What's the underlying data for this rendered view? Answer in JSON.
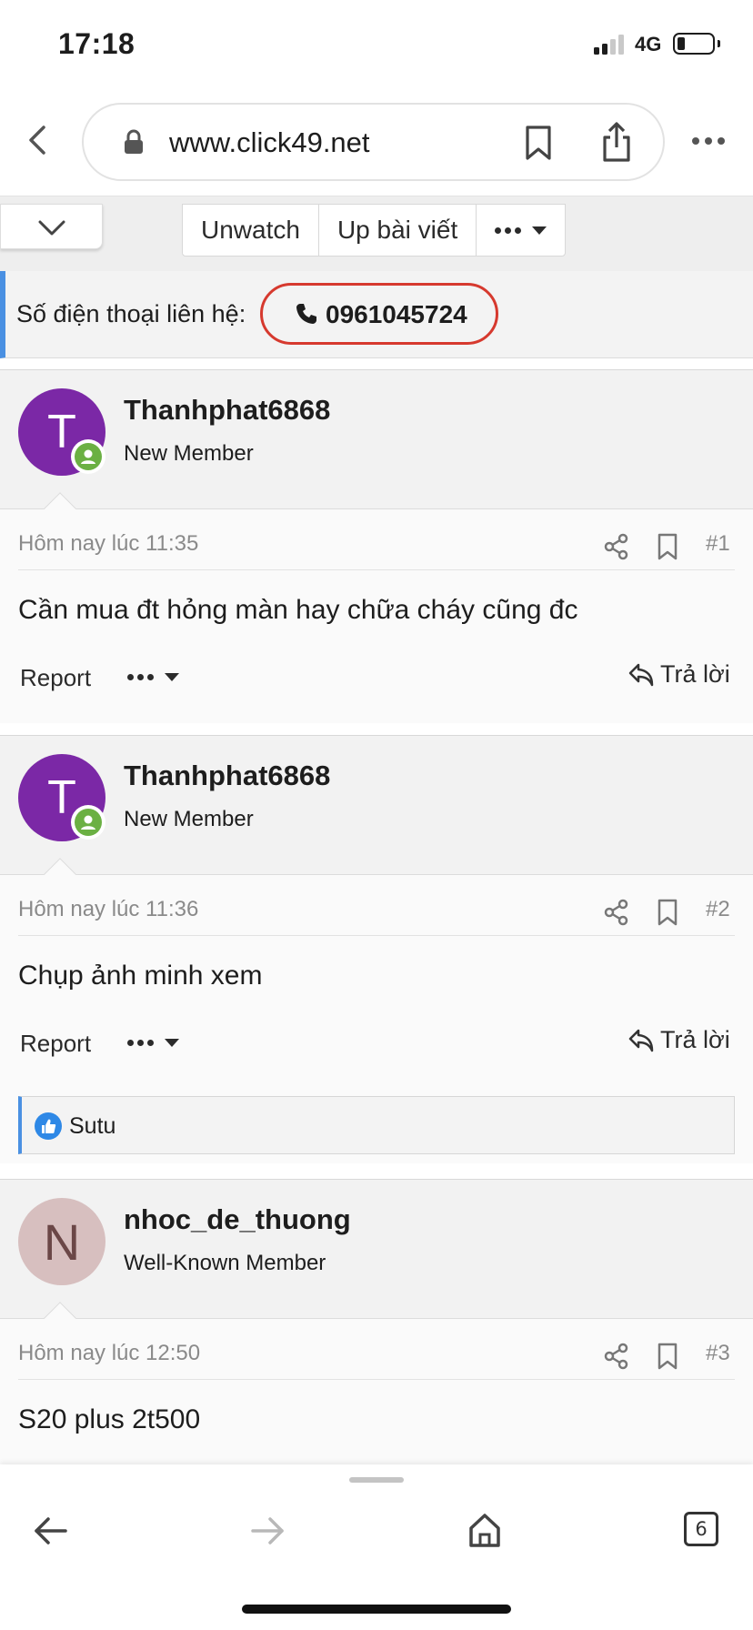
{
  "status_bar": {
    "time": "17:18",
    "network": "4G"
  },
  "browser": {
    "url": "www.click49.net",
    "tab_count": "6"
  },
  "toolbar": {
    "unwatch": "Unwatch",
    "post_upload": "Up bài viết"
  },
  "contact": {
    "label": "Số điện thoại liên hệ:",
    "phone": "0961045724"
  },
  "labels": {
    "report": "Report",
    "reply": "Trả lời"
  },
  "posts": [
    {
      "avatar_letter": "T",
      "username": "Thanhphat6868",
      "user_title": "New Member",
      "timestamp": "Hôm nay lúc 11:35",
      "number": "#1",
      "content": "Cần mua đt hỏng màn hay chữa cháy cũng đc"
    },
    {
      "avatar_letter": "T",
      "username": "Thanhphat6868",
      "user_title": "New Member",
      "timestamp": "Hôm nay lúc 11:36",
      "number": "#2",
      "content": "Chụp ảnh minh xem",
      "reaction_user": "Sutu"
    },
    {
      "avatar_letter": "N",
      "username": "nhoc_de_thuong",
      "user_title": "Well-Known Member",
      "timestamp": "Hôm nay lúc 12:50",
      "number": "#3",
      "content": "S20 plus 2t500"
    }
  ],
  "colors": {
    "avatar_purple": "#7b28a6",
    "avatar_pink": "#d7bfbf",
    "online_green": "#6bb043",
    "phone_highlight": "#d6392e",
    "accent_blue": "#4a90e2"
  }
}
